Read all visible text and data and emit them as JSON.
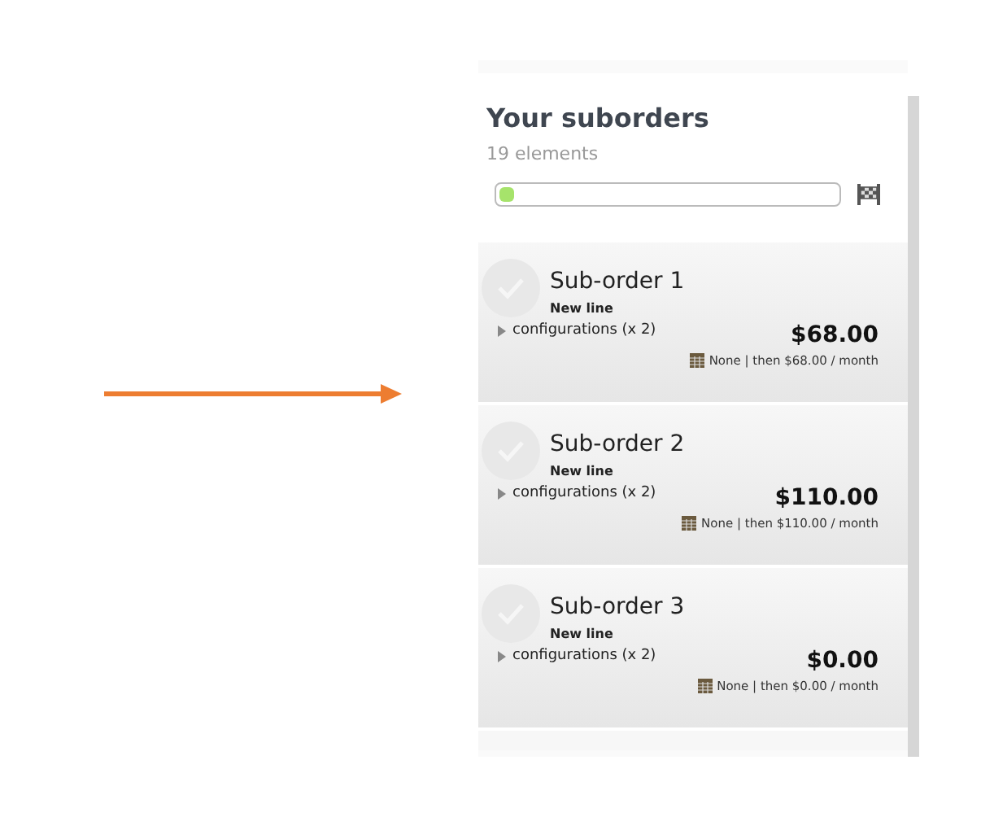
{
  "title": "Your suborders",
  "count": "19 elements",
  "progress": {
    "level": 0.04
  },
  "suborders": [
    {
      "name": "Sub-order 1",
      "tag": "New line",
      "checked": false,
      "configurations": "configurations (x 2)",
      "expanded": false,
      "price": "$68.00",
      "schedule": "None | then $68.00 / month"
    },
    {
      "name": "Sub-order 2",
      "tag": "New line",
      "checked": false,
      "configurations": "configurations (x 2)",
      "expanded": false,
      "price": "$110.00",
      "schedule": "None | then $110.00 / month"
    },
    {
      "name": "Sub-order 3",
      "tag": "New line",
      "checked": false,
      "configurations": "configurations (x 2)",
      "expanded": false,
      "price": "$0.00",
      "schedule": "None | then $0.00 / month"
    }
  ]
}
